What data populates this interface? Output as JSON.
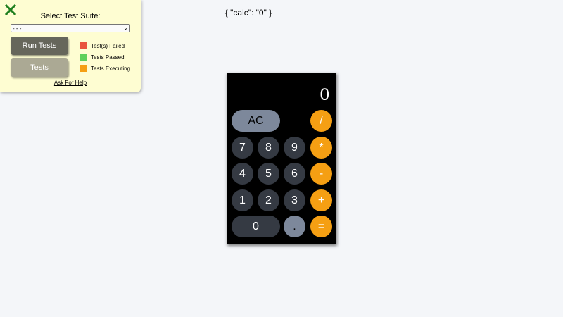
{
  "panel": {
    "title": "Select Test Suite:",
    "select_value": "- - -",
    "run_label": "Run Tests",
    "tests_label": "Tests",
    "legend": [
      {
        "label": "Test(s) Failed",
        "color": "#e9543d"
      },
      {
        "label": "Tests Passed",
        "color": "#5fd05a"
      },
      {
        "label": "Tests Executing",
        "color": "#f59f13"
      }
    ],
    "help": "Ask For Help",
    "close_color": "#1f7f1f"
  },
  "state_text": "{ \"calc\": \"0\" }",
  "calculator": {
    "display": "0",
    "keys": {
      "ac": "AC",
      "divide": "/",
      "multiply": "*",
      "minus": "-",
      "plus": "+",
      "equals": "=",
      "dot": ".",
      "k0": "0",
      "k1": "1",
      "k2": "2",
      "k3": "3",
      "k4": "4",
      "k5": "5",
      "k6": "6",
      "k7": "7",
      "k8": "8",
      "k9": "9"
    }
  }
}
